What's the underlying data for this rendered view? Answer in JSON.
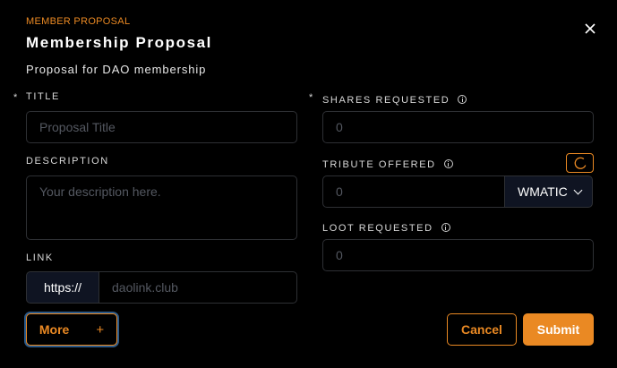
{
  "header": {
    "eyebrow": "MEMBER PROPOSAL",
    "title": "Membership Proposal",
    "subtitle": "Proposal for DAO membership",
    "close_icon": "close-icon"
  },
  "form": {
    "title": {
      "required_mark": "*",
      "label": "TITLE",
      "placeholder": "Proposal Title",
      "value": ""
    },
    "description": {
      "label": "DESCRIPTION",
      "placeholder": "Your description here.",
      "value": ""
    },
    "link": {
      "label": "LINK",
      "prefix": "https://",
      "placeholder": "daolink.club",
      "value": ""
    },
    "shares": {
      "required_mark": "*",
      "label": "SHARES REQUESTED",
      "placeholder": "0",
      "value": "",
      "info_icon": "info-icon"
    },
    "tribute": {
      "label": "TRIBUTE OFFERED",
      "placeholder": "0",
      "value": "",
      "info_icon": "info-icon",
      "token": "WMATIC",
      "spinner_icon": "loading-spinner-icon"
    },
    "loot": {
      "label": "LOOT REQUESTED",
      "placeholder": "0",
      "value": "",
      "info_icon": "info-icon"
    }
  },
  "actions": {
    "more_label": "More",
    "more_icon": "+",
    "cancel_label": "Cancel",
    "submit_label": "Submit"
  },
  "colors": {
    "accent": "#ea8923",
    "background": "#000000",
    "input_border": "#2e3034",
    "addon_background": "#0f1422"
  }
}
